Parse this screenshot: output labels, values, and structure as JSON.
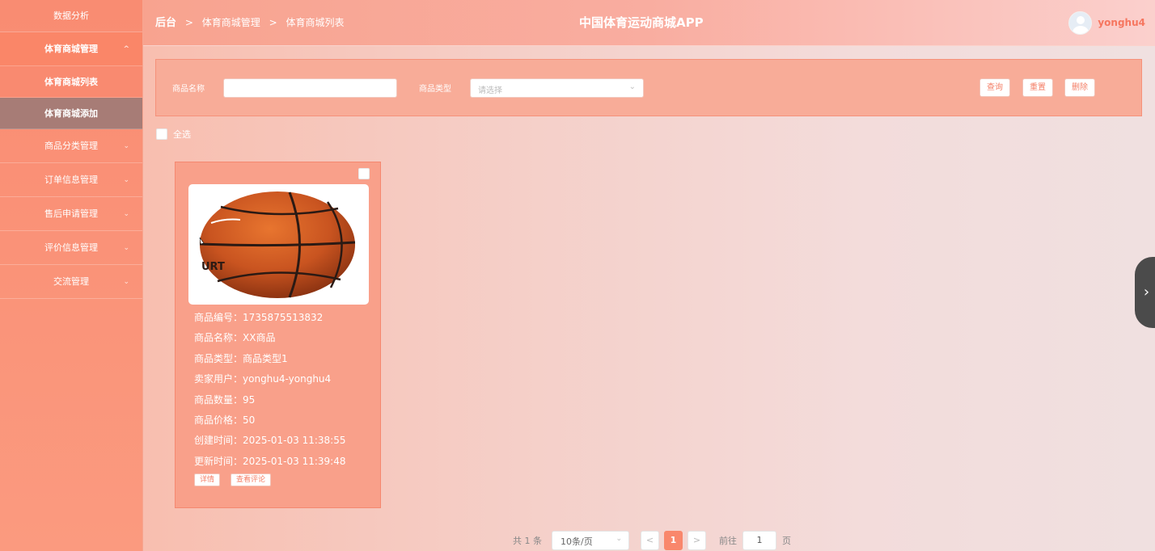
{
  "sidebar": {
    "top_item": "数据分析",
    "group_open": {
      "label": "体育商城管理",
      "chevron": "^"
    },
    "sub_items": [
      {
        "label": "体育商城列表"
      },
      {
        "label": "体育商城添加"
      }
    ],
    "items": [
      {
        "label": "商品分类管理",
        "chevron": "⌄"
      },
      {
        "label": "订单信息管理",
        "chevron": "⌄"
      },
      {
        "label": "售后申请管理",
        "chevron": "⌄"
      },
      {
        "label": "评价信息管理",
        "chevron": "⌄"
      },
      {
        "label": "交流管理",
        "chevron": "⌄"
      }
    ]
  },
  "header": {
    "breadcrumb": [
      "后台",
      "体育商城管理",
      "体育商城列表"
    ],
    "separator": ">",
    "title": "中国体育运动商城APP",
    "username": "yonghu4"
  },
  "search": {
    "name_label": "商品名称",
    "name_value": "",
    "type_label": "商品类型",
    "type_placeholder": "请选择",
    "query_button": "查询",
    "reset_button": "重置",
    "delete_button": "删除"
  },
  "select_all": {
    "label": "全选"
  },
  "product": {
    "fields": [
      {
        "label": "商品编号：",
        "value": "1735875513832"
      },
      {
        "label": "商品名称：",
        "value": "XX商品"
      },
      {
        "label": "商品类型：",
        "value": "商品类型1"
      },
      {
        "label": "卖家用户：",
        "value": "yonghu4-yonghu4"
      },
      {
        "label": "商品数量：",
        "value": "95"
      },
      {
        "label": "商品价格：",
        "value": "50"
      },
      {
        "label": "创建时间：",
        "value": "2025-01-03 11:38:55"
      },
      {
        "label": "更新时间：",
        "value": "2025-01-03 11:39:48"
      }
    ],
    "detail_button": "详情",
    "reviews_button": "查看评论",
    "ball_text": "URT"
  },
  "pagination": {
    "total": "共 1 条",
    "page_size": "10条/页",
    "prev": "<",
    "current_page": "1",
    "next": ">",
    "goto_prefix": "前往",
    "goto_value": "1",
    "goto_suffix": "页"
  },
  "edge_handle": {
    "glyph": "›"
  },
  "colors": {
    "accent": "#f9876c",
    "sidebar": "#f98c72",
    "active_sub": "#a77c76"
  }
}
